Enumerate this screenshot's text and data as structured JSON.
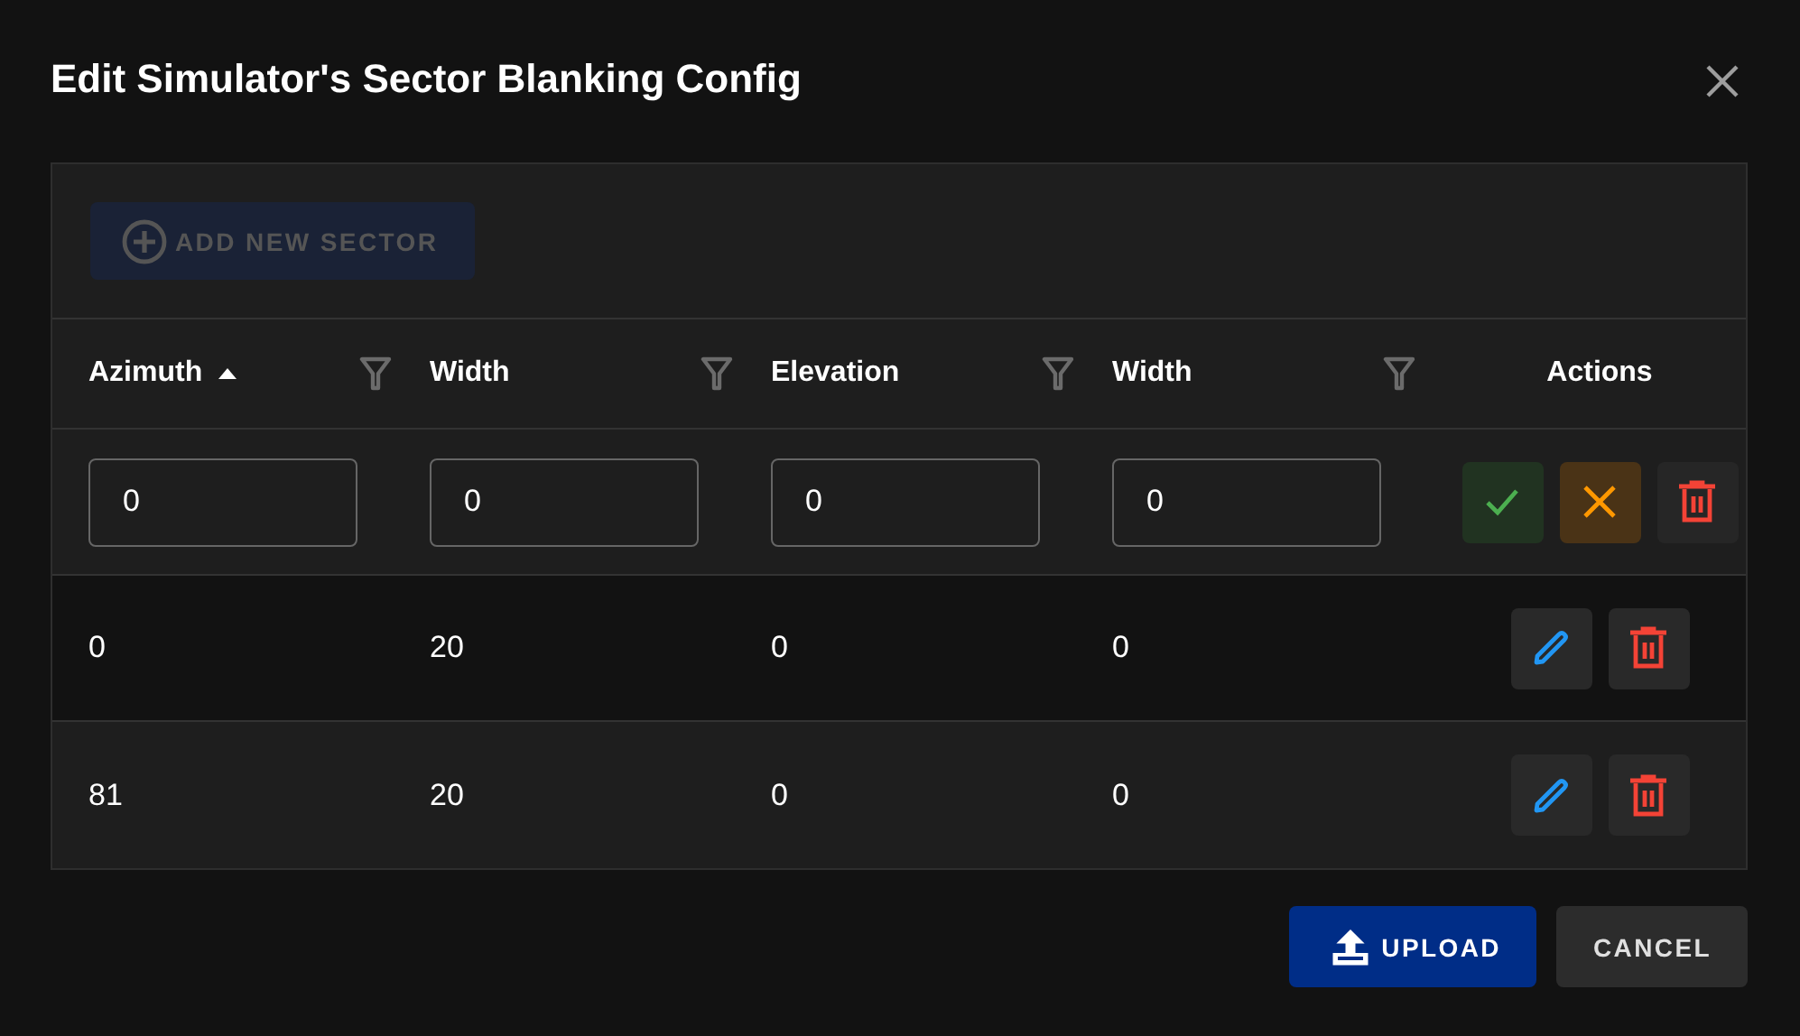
{
  "dialog": {
    "title": "Edit Simulator's Sector Blanking Config"
  },
  "toolbar": {
    "add_button": {
      "label": "ADD NEW SECTOR",
      "disabled": true
    }
  },
  "columns": [
    {
      "label": "Azimuth",
      "sorted": true,
      "filterable": true
    },
    {
      "label": "Width",
      "sorted": false,
      "filterable": true
    },
    {
      "label": "Elevation",
      "sorted": false,
      "filterable": true
    },
    {
      "label": "Width",
      "sorted": false,
      "filterable": true
    }
  ],
  "actions_column": {
    "label": "Actions"
  },
  "edit_row": {
    "values": [
      "0",
      "0",
      "0",
      "0"
    ]
  },
  "rows": [
    {
      "cells": [
        "0",
        "20",
        "0",
        "0"
      ]
    },
    {
      "cells": [
        "81",
        "20",
        "0",
        "0"
      ]
    }
  ],
  "footer": {
    "upload_button": "UPLOAD",
    "cancel_button": "CANCEL"
  }
}
